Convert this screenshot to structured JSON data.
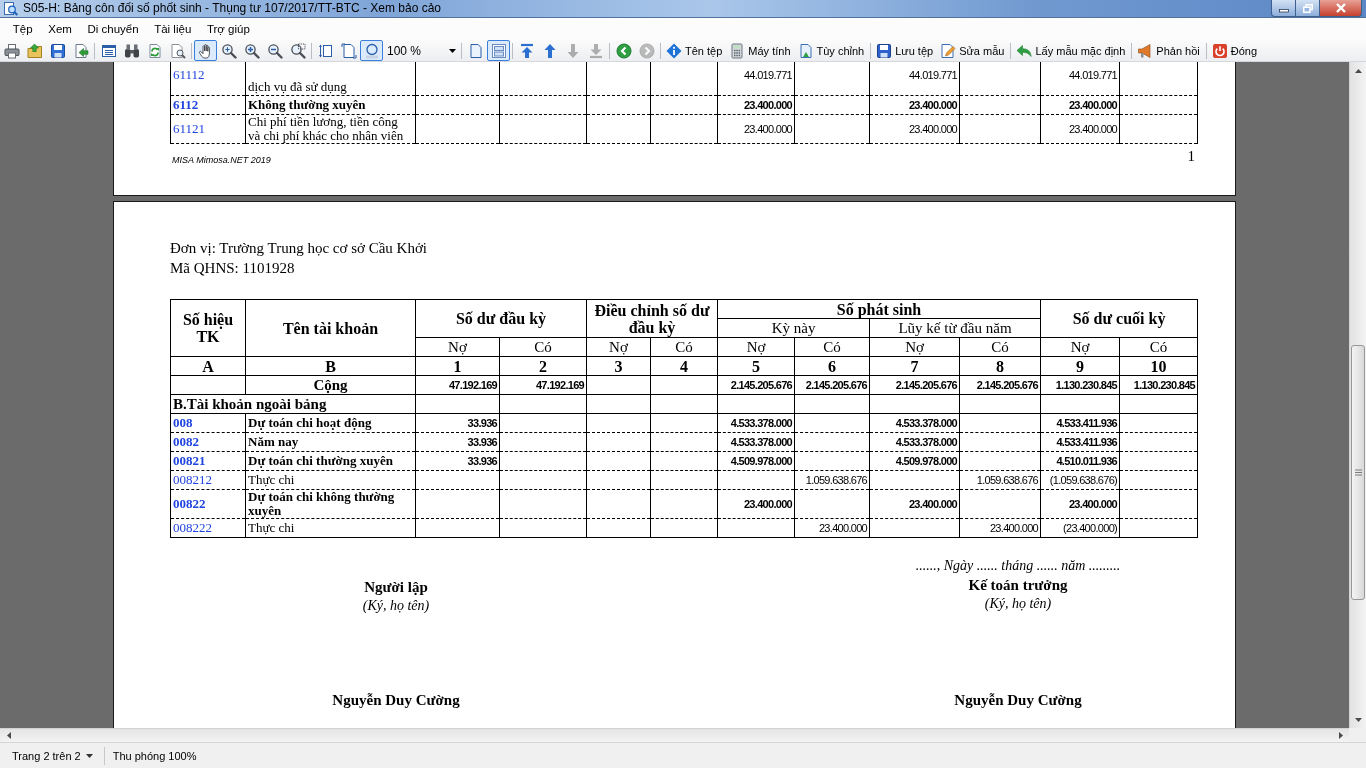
{
  "window": {
    "title": "S05-H: Bảng côn đối số phốt sinh - Thụng tư 107/2017/TT-BTC - Xem bảo cảo"
  },
  "menu": [
    "Tệp",
    "Xem",
    "Di chuyển",
    "Tài liệu",
    "Trợ giúp"
  ],
  "toolbar": {
    "groups": [
      {
        "items": [
          {
            "kind": "icon",
            "pressed": false,
            "disabled": false
          },
          {
            "kind": "icon",
            "pressed": false,
            "disabled": false
          },
          {
            "kind": "icon",
            "pressed": false,
            "disabled": false
          },
          {
            "kind": "icon",
            "pressed": false,
            "disabled": false
          }
        ]
      },
      {
        "items": [
          {
            "kind": "icon",
            "pressed": false,
            "disabled": false
          },
          {
            "kind": "icon",
            "pressed": false,
            "disabled": false
          },
          {
            "kind": "icon",
            "pressed": false,
            "disabled": false
          },
          {
            "kind": "icon",
            "pressed": false,
            "disabled": false
          }
        ]
      },
      {
        "items": [
          {
            "kind": "icon",
            "pressed": true,
            "disabled": false
          },
          {
            "kind": "icon",
            "pressed": false,
            "disabled": false
          },
          {
            "kind": "icon",
            "pressed": false,
            "disabled": false
          },
          {
            "kind": "icon",
            "pressed": false,
            "disabled": false
          },
          {
            "kind": "icon",
            "pressed": false,
            "disabled": false
          }
        ]
      },
      {
        "items": [
          {
            "kind": "icon",
            "pressed": false,
            "disabled": false
          },
          {
            "kind": "icon",
            "pressed": false,
            "disabled": false
          },
          {
            "kind": "icon",
            "pressed": true,
            "disabled": false
          },
          {
            "kind": "combo",
            "value": "100 %"
          }
        ]
      },
      {
        "items": [
          {
            "kind": "icon",
            "pressed": false,
            "disabled": false
          },
          {
            "kind": "icon",
            "pressed": true,
            "disabled": false
          }
        ]
      },
      {
        "items": [
          {
            "kind": "icon",
            "pressed": false,
            "disabled": false
          },
          {
            "kind": "icon",
            "pressed": false,
            "disabled": false
          },
          {
            "kind": "icon",
            "pressed": false,
            "disabled": true
          },
          {
            "kind": "icon",
            "pressed": false,
            "disabled": true
          }
        ]
      },
      {
        "items": [
          {
            "kind": "icon",
            "pressed": false,
            "disabled": false
          },
          {
            "kind": "icon",
            "pressed": false,
            "disabled": true
          }
        ]
      },
      {
        "items": [
          {
            "kind": "labeled",
            "label": "Tên tệp",
            "pressed": false,
            "disabled": false
          },
          {
            "kind": "labeled",
            "label": "Máy tính",
            "pressed": false,
            "disabled": false
          },
          {
            "kind": "labeled",
            "label": "Tùy chỉnh",
            "pressed": false,
            "disabled": false
          }
        ]
      },
      {
        "items": [
          {
            "kind": "labeled",
            "label": "Lưu tệp",
            "pressed": false,
            "disabled": false
          },
          {
            "kind": "labeled",
            "label": "Sửa mẫu",
            "pressed": false,
            "disabled": false
          }
        ]
      },
      {
        "items": [
          {
            "kind": "labeled",
            "label": "Lấy mẫu mặc định",
            "pressed": false,
            "disabled": false
          }
        ]
      },
      {
        "items": [
          {
            "kind": "labeled",
            "label": "Phản hồi",
            "pressed": false,
            "disabled": false
          }
        ]
      },
      {
        "items": [
          {
            "kind": "labeled",
            "label": "Đóng",
            "pressed": false,
            "disabled": false
          }
        ]
      }
    ]
  },
  "page_1": {
    "rows": [
      {
        "kind": "account",
        "code": "61112",
        "name": "dịch vụ đã sử dụng",
        "bold": false,
        "period_debit": "44.019.771",
        "ytd_debit": "44.019.771",
        "closing_debit": "44.019.771"
      },
      {
        "kind": "account",
        "code": "6112",
        "name": "Không thường xuyên",
        "bold": true,
        "period_debit": "23.400.000",
        "ytd_debit": "23.400.000",
        "closing_debit": "23.400.000"
      },
      {
        "kind": "account",
        "code": "61121",
        "name": "Chi phí tiền lương, tiền công và chi phí khác cho nhân viên",
        "bold": false,
        "period_debit": "23.400.000",
        "ytd_debit": "23.400.000",
        "closing_debit": "23.400.000"
      }
    ],
    "footer": "MISA Mimosa.NET 2019",
    "page_number": "1"
  },
  "page_2": {
    "unit": "Đơn vị: Trường Trung học cơ sở Cầu Khởi",
    "budget_code": "Mã QHNS: 1101928",
    "table": {
      "header": {
        "columns": [
          {
            "label": "Số hiệu TK"
          },
          {
            "label": "Tên tài khoản"
          },
          {
            "label": "Số dư đầu kỳ",
            "sides": [
              "Nợ",
              "Có"
            ]
          },
          {
            "label": "Điều chỉnh số dư đầu kỳ",
            "sides": [
              "Nợ",
              "Có"
            ]
          },
          {
            "label": "Số phát sinh",
            "periods": [
              {
                "label": "Kỳ này",
                "sides": [
                  "Nợ",
                  "Có"
                ]
              },
              {
                "label": "Lũy kế từ đầu năm",
                "sides": [
                  "Nợ",
                  "Có"
                ]
              }
            ]
          },
          {
            "label": "Số dư cuối kỳ",
            "sides": [
              "Nợ",
              "Có"
            ]
          }
        ],
        "column_numbers": [
          "A",
          "B",
          "1",
          "2",
          "3",
          "4",
          "5",
          "6",
          "7",
          "8",
          "9",
          "10"
        ]
      },
      "rows": [
        {
          "kind": "total",
          "name": "Cộng",
          "bold": true,
          "opening_debit": "47.192.169",
          "opening_credit": "47.192.169",
          "period_debit": "2.145.205.676",
          "period_credit": "2.145.205.676",
          "ytd_debit": "2.145.205.676",
          "ytd_credit": "2.145.205.676",
          "closing_debit": "1.130.230.845",
          "closing_credit": "1.130.230.845"
        },
        {
          "kind": "section",
          "name": "B.Tài khoản ngoài bảng",
          "bold": true
        },
        {
          "kind": "account",
          "code": "008",
          "name": "Dự toán chi hoạt động",
          "bold": true,
          "opening_debit": "33.936",
          "period_debit": "4.533.378.000",
          "ytd_debit": "4.533.378.000",
          "closing_debit": "4.533.411.936"
        },
        {
          "kind": "account",
          "code": "0082",
          "name": "Năm nay",
          "bold": true,
          "opening_debit": "33.936",
          "period_debit": "4.533.378.000",
          "ytd_debit": "4.533.378.000",
          "closing_debit": "4.533.411.936"
        },
        {
          "kind": "account",
          "code": "00821",
          "name": "Dự toán chi thường xuyên",
          "bold": true,
          "opening_debit": "33.936",
          "period_debit": "4.509.978.000",
          "ytd_debit": "4.509.978.000",
          "closing_debit": "4.510.011.936"
        },
        {
          "kind": "account",
          "code": "008212",
          "name": "Thực chi",
          "bold": false,
          "period_credit": "1.059.638.676",
          "ytd_credit": "1.059.638.676",
          "closing_debit": "(1.059.638.676)"
        },
        {
          "kind": "account",
          "code": "00822",
          "name": "Dự toán chi không thường xuyên",
          "bold": true,
          "period_debit": "23.400.000",
          "ytd_debit": "23.400.000",
          "closing_debit": "23.400.000"
        },
        {
          "kind": "account",
          "code": "008222",
          "name": "Thực chi",
          "bold": false,
          "period_credit": "23.400.000",
          "ytd_credit": "23.400.000",
          "closing_debit": "(23.400.000)"
        }
      ]
    },
    "signatures": [
      {
        "title": "Người lập",
        "note": "(Ký, họ tên)",
        "name": "Nguyễn Duy Cường"
      },
      {
        "date_line": "......, Ngày ...... tháng ...... năm .........",
        "title": "Kế toán trưởng",
        "note": "(Ký, họ tên)",
        "name": "Nguyễn Duy Cường"
      }
    ]
  },
  "status_bar": {
    "page": "Trang 2 trên 2",
    "zoom": "Thu phóng 100%"
  }
}
